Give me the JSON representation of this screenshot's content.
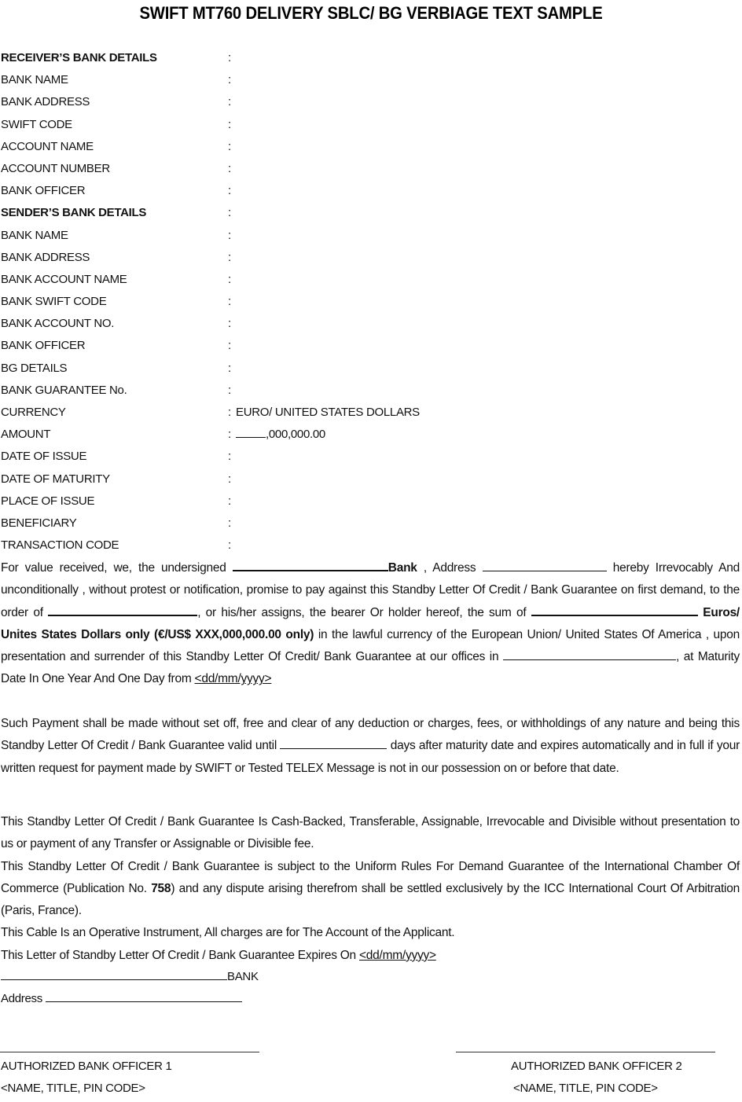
{
  "document": {
    "title": "SWIFT MT760 DELIVERY SBLC/ BG VERBIAGE TEXT SAMPLE"
  },
  "fields": [
    {
      "label": "RECEIVER’S BANK DETAILS",
      "bold": true,
      "colon": ":",
      "value": ""
    },
    {
      "label": "BANK NAME",
      "bold": false,
      "colon": ":",
      "value": ""
    },
    {
      "label": "BANK ADDRESS",
      "bold": false,
      "colon": ":",
      "value": ""
    },
    {
      "label": "SWIFT CODE",
      "bold": false,
      "colon": ":",
      "value": ""
    },
    {
      "label": "ACCOUNT NAME",
      "bold": false,
      "colon": ":",
      "value": ""
    },
    {
      "label": "ACCOUNT NUMBER",
      "bold": false,
      "colon": ":",
      "value": ""
    },
    {
      "label": "BANK OFFICER",
      "bold": false,
      "colon": ":",
      "value": ""
    },
    {
      "label": "SENDER’S BANK DETAILS",
      "bold": true,
      "colon": ":",
      "value": ""
    },
    {
      "label": "BANK NAME",
      "bold": false,
      "colon": ":",
      "value": ""
    },
    {
      "label": "BANK ADDRESS",
      "bold": false,
      "colon": ":",
      "value": ""
    },
    {
      "label": "BANK ACCOUNT NAME",
      "bold": false,
      "colon": ":",
      "value": ""
    },
    {
      "label": "BANK SWIFT CODE",
      "bold": false,
      "colon": ":",
      "value": ""
    },
    {
      "label": "BANK ACCOUNT NO.",
      "bold": false,
      "colon": ":",
      "value": ""
    },
    {
      "label": "BANK OFFICER",
      "bold": false,
      "colon": ":",
      "value": ""
    },
    {
      "label": "BG DETAILS",
      "bold": false,
      "colon": ":",
      "value": ""
    },
    {
      "label": "BANK GUARANTEE No.",
      "bold": false,
      "colon": ":",
      "value": ""
    },
    {
      "label": "CURRENCY",
      "bold": false,
      "colon": ":",
      "value": "EURO/ UNITED STATES DOLLARS"
    },
    {
      "label": "AMOUNT",
      "bold": false,
      "colon": ":",
      "value": ",000,000.00",
      "blank_before_value": true
    },
    {
      "label": "DATE OF ISSUE",
      "bold": false,
      "colon": ":",
      "value": ""
    },
    {
      "label": "DATE OF MATURITY",
      "bold": false,
      "colon": ":",
      "value": ""
    },
    {
      "label": "PLACE OF ISSUE",
      "bold": false,
      "colon": ":",
      "value": ""
    },
    {
      "label": "BENEFICIARY",
      "bold": false,
      "colon": ":",
      "value": ""
    },
    {
      "label": "TRANSACTION CODE",
      "bold": false,
      "colon": ":",
      "value": ""
    }
  ],
  "body": {
    "p1": {
      "t1": "For value received, we, the undersigned ",
      "t2": "Bank",
      "t3": " , Address ",
      "t4": " hereby Irrevocably And unconditionally , without protest or notification, promise to pay against this Standby Letter Of Credit / Bank Guarantee on first demand, to the order of ",
      "t5": ", or his/her assigns, the bearer Or holder hereof, the sum of ",
      "t6": " Euros/ Unites States Dollars only (€/US$ XXX,000,000.00 only)",
      "t7": "  in the lawful currency of the European Union/ United States Of America , upon presentation and surrender of this Standby Letter Of Credit/ Bank Guarantee at our offices in ",
      "t8": ", at Maturity Date In One Year And One Day from ",
      "date": "<dd/mm/yyyy>",
      "t9": "Such Payment shall be made without set off, free and clear of any deduction or charges, fees, or withholdings of any nature and being this Standby Letter Of Credit / Bank Guarantee valid until ",
      "t10": " days after maturity date and expires automatically and in full if your written request for payment made by SWIFT or Tested TELEX Message is not in our possession on or before that date."
    },
    "p3": {
      "cash_backed": "This Standby Letter Of Credit / Bank Guarantee Is Cash-Backed, Transferable, Assignable, Irrevocable and Divisible without presentation to us or payment of any Transfer or Assignable or Divisible fee.",
      "urdg_1": "This Standby Letter Of Credit / Bank Guarantee is subject to the Uniform Rules For Demand Guarantee of the International Chamber Of Commerce (Publication No. ",
      "urdg_pub": "758",
      "urdg_2": ") and any dispute arising therefrom shall be settled exclusively by the ICC International Court Of Arbitration (Paris, France).",
      "cable": "This Cable Is an Operative Instrument, All charges are for The Account of the Applicant.",
      "expires": "This Letter of Standby Letter Of Credit / Bank Guarantee Expires On ",
      "expires_date": "<dd/mm/yyyy>"
    }
  },
  "signature": {
    "bank_label": "BANK",
    "address_label": "Address",
    "officer1_title": "AUTHORIZED BANK OFFICER 1",
    "officer1_sub": "<NAME, TITLE, PIN CODE>",
    "officer2_title": "AUTHORIZED BANK OFFICER 2",
    "officer2_sub": "<NAME, TITLE, PIN CODE>"
  }
}
